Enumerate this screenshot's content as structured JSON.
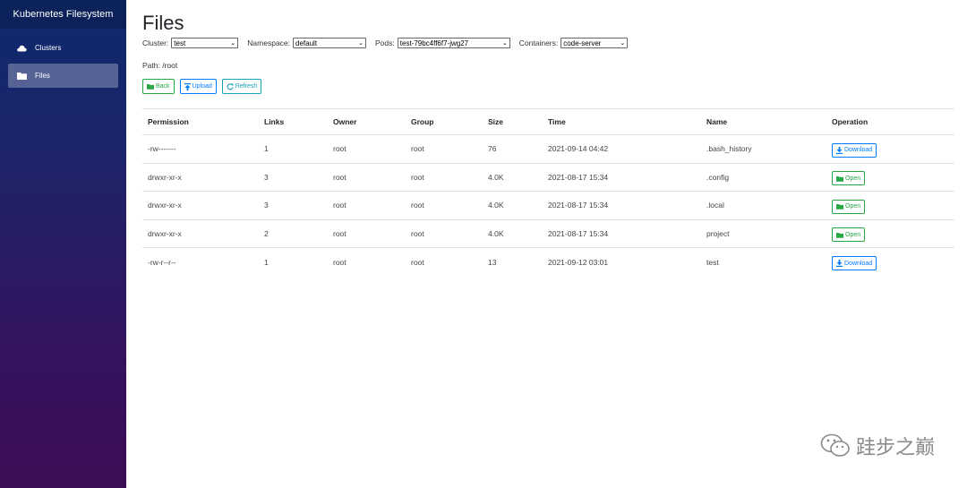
{
  "sidebar": {
    "brand": "Kubernetes Filesystem",
    "items": [
      {
        "label": "Clusters",
        "icon": "cloud-icon",
        "active": false
      },
      {
        "label": "Files",
        "icon": "folder-icon",
        "active": true
      }
    ]
  },
  "page": {
    "title": "Files",
    "filters": {
      "cluster": {
        "label": "Cluster:",
        "value": "test"
      },
      "namespace": {
        "label": "Namespace:",
        "value": "default"
      },
      "pods": {
        "label": "Pods:",
        "value": "test-79bc4ff6f7-jwg27"
      },
      "containers": {
        "label": "Containers:",
        "value": "code-server"
      }
    },
    "path": "Path: /root",
    "buttons": {
      "back": "Back",
      "upload": "Upload",
      "refresh": "Refresh"
    }
  },
  "table": {
    "headers": [
      "Permission",
      "Links",
      "Owner",
      "Group",
      "Size",
      "Time",
      "Name",
      "Operation"
    ],
    "rows": [
      {
        "permission": "-rw-------",
        "links": "1",
        "owner": "root",
        "group": "root",
        "size": "76",
        "time": "2021-09-14 04:42",
        "name": ".bash_history",
        "operation": "Download",
        "op_type": "download"
      },
      {
        "permission": "drwxr-xr-x",
        "links": "3",
        "owner": "root",
        "group": "root",
        "size": "4.0K",
        "time": "2021-08-17 15:34",
        "name": ".config",
        "operation": "Open",
        "op_type": "open"
      },
      {
        "permission": "drwxr-xr-x",
        "links": "3",
        "owner": "root",
        "group": "root",
        "size": "4.0K",
        "time": "2021-08-17 15:34",
        "name": ".local",
        "operation": "Open",
        "op_type": "open"
      },
      {
        "permission": "drwxr-xr-x",
        "links": "2",
        "owner": "root",
        "group": "root",
        "size": "4.0K",
        "time": "2021-08-17 15:34",
        "name": "project",
        "operation": "Open",
        "op_type": "open"
      },
      {
        "permission": "-rw-r--r--",
        "links": "1",
        "owner": "root",
        "group": "root",
        "size": "13",
        "time": "2021-09-12 03:01",
        "name": "test",
        "operation": "Download",
        "op_type": "download"
      }
    ]
  },
  "watermark": {
    "text": "跬步之巅"
  },
  "colors": {
    "green": "#28a745",
    "blue": "#007bff",
    "teal": "#17a2b8"
  }
}
